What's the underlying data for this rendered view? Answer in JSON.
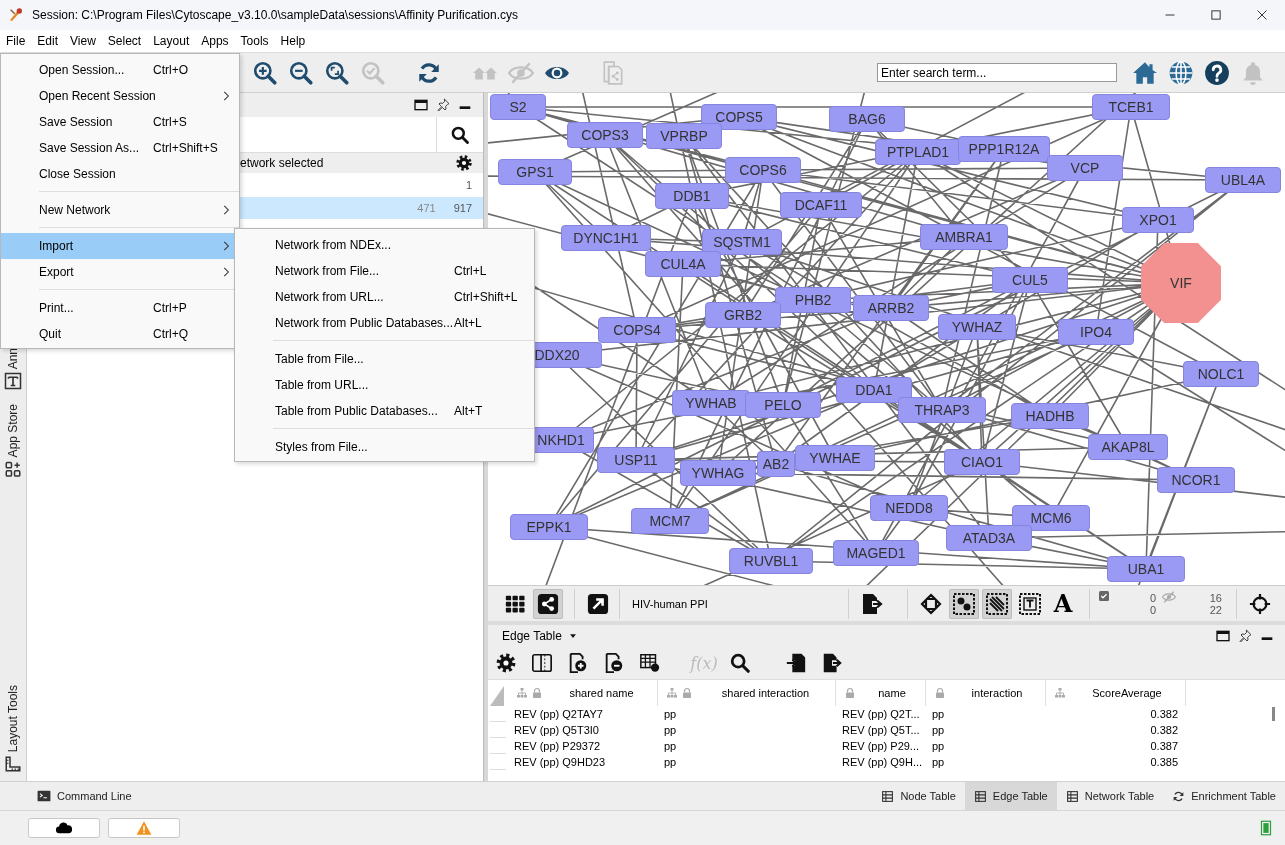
{
  "window": {
    "title": "Session: C:\\Program Files\\Cytoscape_v3.10.0\\sampleData\\sessions\\Affinity Purification.cys"
  },
  "menu_bar": [
    "File",
    "Edit",
    "View",
    "Select",
    "Layout",
    "Apps",
    "Tools",
    "Help"
  ],
  "file_menu": [
    {
      "kind": "item",
      "label": "Open Session...",
      "shortcut": "Ctrl+O",
      "submenu": false,
      "selected": false
    },
    {
      "kind": "item",
      "label": "Open Recent Session",
      "submenu": true,
      "selected": false
    },
    {
      "kind": "item",
      "label": "Save Session",
      "shortcut": "Ctrl+S",
      "submenu": false,
      "selected": false
    },
    {
      "kind": "item",
      "label": "Save Session As...",
      "shortcut": "Ctrl+Shift+S",
      "submenu": false,
      "selected": false
    },
    {
      "kind": "item",
      "label": "Close Session",
      "submenu": false,
      "selected": false
    },
    {
      "kind": "separator"
    },
    {
      "kind": "item",
      "label": "New Network",
      "submenu": true,
      "selected": false
    },
    {
      "kind": "separator"
    },
    {
      "kind": "item",
      "label": "Import",
      "submenu": true,
      "selected": true
    },
    {
      "kind": "item",
      "label": "Export",
      "submenu": true,
      "selected": false
    },
    {
      "kind": "separator"
    },
    {
      "kind": "item",
      "label": "Print...",
      "shortcut": "Ctrl+P",
      "submenu": false,
      "selected": false
    },
    {
      "kind": "item",
      "label": "Quit",
      "shortcut": "Ctrl+Q",
      "submenu": false,
      "selected": false
    }
  ],
  "import_submenu": [
    {
      "kind": "item",
      "label": "Network from NDEx..."
    },
    {
      "kind": "item",
      "label": "Network from File...",
      "shortcut": "Ctrl+L"
    },
    {
      "kind": "item",
      "label": "Network from URL...",
      "shortcut": "Ctrl+Shift+L"
    },
    {
      "kind": "item",
      "label": "Network from Public Databases...",
      "shortcut": "Alt+L"
    },
    {
      "kind": "separator"
    },
    {
      "kind": "item",
      "label": "Table from File..."
    },
    {
      "kind": "item",
      "label": "Table from URL..."
    },
    {
      "kind": "item",
      "label": "Table from Public Databases...",
      "shortcut": "Alt+T"
    },
    {
      "kind": "separator"
    },
    {
      "kind": "item",
      "label": "Styles from File..."
    }
  ],
  "toolbar": {
    "buttons": [
      {
        "kind": "zoom-in",
        "disabled": false
      },
      {
        "kind": "zoom-out",
        "disabled": false
      },
      {
        "kind": "zoom-fit",
        "disabled": false
      },
      {
        "kind": "zoom-check",
        "disabled": true
      },
      {
        "kind": "refresh",
        "disabled": false
      },
      {
        "kind": "houses",
        "disabled": true
      },
      {
        "kind": "eye-slash",
        "disabled": true
      },
      {
        "kind": "eye",
        "disabled": false
      },
      {
        "kind": "documents",
        "disabled": true
      }
    ],
    "search": {
      "placeholder": "Enter search term..."
    },
    "right_buttons": [
      {
        "kind": "home",
        "disabled": false
      },
      {
        "kind": "globe",
        "disabled": false
      },
      {
        "kind": "help",
        "disabled": false
      },
      {
        "kind": "bell",
        "disabled": true
      }
    ]
  },
  "side_tabs": [
    {
      "kind": "annotation",
      "label": "Ann"
    },
    {
      "kind": "app-store",
      "label": "App Store"
    },
    {
      "kind": "layout-tools",
      "label": "Layout Tools"
    }
  ],
  "network_panel": {
    "status": "etwork selected",
    "rows": [
      {
        "values": [
          "1"
        ],
        "selected": false
      },
      {
        "values": [
          "471",
          "917"
        ],
        "selected": true
      }
    ]
  },
  "network_view": {
    "nodes": [
      {
        "label": "S2",
        "kind": "rect"
      },
      {
        "label": "COPS5",
        "kind": "rect"
      },
      {
        "label": "BAG6",
        "kind": "rect"
      },
      {
        "label": "TCEB1",
        "kind": "rect"
      },
      {
        "label": "COPS3",
        "kind": "rect"
      },
      {
        "label": "VPRBP",
        "kind": "rect"
      },
      {
        "label": "PTPLAD1",
        "kind": "rect"
      },
      {
        "label": "PPP1R12A",
        "kind": "rect"
      },
      {
        "label": "GPS1",
        "kind": "rect"
      },
      {
        "label": "COPS6",
        "kind": "rect"
      },
      {
        "label": "VCP",
        "kind": "rect"
      },
      {
        "label": "UBL4A",
        "kind": "rect"
      },
      {
        "label": "DDB1",
        "kind": "rect"
      },
      {
        "label": "DCAF11",
        "kind": "rect"
      },
      {
        "label": "XPO1",
        "kind": "rect"
      },
      {
        "label": "DYNC1H1",
        "kind": "rect"
      },
      {
        "label": "SQSTM1",
        "kind": "rect"
      },
      {
        "label": "AMBRA1",
        "kind": "rect"
      },
      {
        "label": "CUL4A",
        "kind": "rect"
      },
      {
        "label": "CUL5",
        "kind": "rect"
      },
      {
        "label": "VIF",
        "kind": "octagon"
      },
      {
        "label": "PHB2",
        "kind": "rect"
      },
      {
        "label": "ARRB2",
        "kind": "rect"
      },
      {
        "label": "GRB2",
        "kind": "rect"
      },
      {
        "label": "COPS4",
        "kind": "rect"
      },
      {
        "label": "YWHAZ",
        "kind": "rect"
      },
      {
        "label": "IPO4",
        "kind": "rect"
      },
      {
        "label": "DDX20",
        "kind": "rect"
      },
      {
        "label": "NOLC1",
        "kind": "rect"
      },
      {
        "label": "DDA1",
        "kind": "rect"
      },
      {
        "label": "THRAP3",
        "kind": "rect"
      },
      {
        "label": "YWHAB",
        "kind": "rect"
      },
      {
        "label": "PELO",
        "kind": "rect"
      },
      {
        "label": "HADHB",
        "kind": "rect"
      },
      {
        "label": "AKAP8L",
        "kind": "rect"
      },
      {
        "label": "NKHD1",
        "kind": "rect"
      },
      {
        "label": "CIAO1",
        "kind": "rect"
      },
      {
        "label": "YWHAE",
        "kind": "rect"
      },
      {
        "label": "AB2",
        "kind": "rect"
      },
      {
        "label": "USP11",
        "kind": "rect"
      },
      {
        "label": "YWHAG",
        "kind": "rect"
      },
      {
        "label": "NCOR1",
        "kind": "rect"
      },
      {
        "label": "NEDD8",
        "kind": "rect"
      },
      {
        "label": "MCM6",
        "kind": "rect"
      },
      {
        "label": "EPPK1",
        "kind": "rect"
      },
      {
        "label": "MCM7",
        "kind": "rect"
      },
      {
        "label": "ATAD3A",
        "kind": "rect"
      },
      {
        "label": "MAGED1",
        "kind": "rect"
      },
      {
        "label": "RUVBL1",
        "kind": "rect"
      },
      {
        "label": "UBA1",
        "kind": "rect"
      }
    ],
    "toolbar": {
      "left_buttons": [
        {
          "kind": "grid",
          "selected": false
        },
        {
          "kind": "share",
          "selected": true
        },
        {
          "kind": "arrow-out",
          "selected": false
        }
      ],
      "network_name": "HIV-human PPI",
      "buttons": [
        {
          "kind": "export",
          "selected": false
        },
        {
          "kind": "move",
          "selected": false
        },
        {
          "kind": "select-nodes",
          "selected": true
        },
        {
          "kind": "select-edges",
          "selected": true
        },
        {
          "kind": "select-annotations",
          "selected": false
        },
        {
          "kind": "text-move",
          "label": "A",
          "selected": false
        }
      ],
      "selected_counts": [
        "0",
        "0"
      ],
      "hidden_counts": [
        "16",
        "22"
      ]
    }
  },
  "edge_table": {
    "title": "Edge Table",
    "toolbar": [
      {
        "kind": "gear",
        "disabled": false
      },
      {
        "kind": "columns",
        "disabled": false
      },
      {
        "kind": "add-column",
        "disabled": false
      },
      {
        "kind": "delete-column",
        "disabled": false
      },
      {
        "kind": "table",
        "disabled": false
      },
      {
        "kind": "function",
        "label": "f(x)",
        "disabled": true
      },
      {
        "kind": "search",
        "disabled": false
      },
      {
        "kind": "import",
        "disabled": false
      },
      {
        "kind": "export",
        "disabled": false
      }
    ],
    "columns": [
      {
        "label": "shared name",
        "shared": true,
        "locked": true
      },
      {
        "label": "shared interaction",
        "shared": true,
        "locked": true
      },
      {
        "label": "name",
        "shared": false,
        "locked": true
      },
      {
        "label": "interaction",
        "shared": false,
        "locked": true
      },
      {
        "label": "ScoreAverage",
        "shared": true,
        "locked": false
      }
    ],
    "rows": [
      [
        "REV (pp) Q2TAY7",
        "pp",
        "REV (pp) Q2T...",
        "pp",
        "0.382"
      ],
      [
        "REV (pp) Q5T3I0",
        "pp",
        "REV (pp) Q5T...",
        "pp",
        "0.382"
      ],
      [
        "REV (pp) P29372",
        "pp",
        "REV (pp) P29...",
        "pp",
        "0.387"
      ],
      [
        "REV (pp) Q9HD23",
        "pp",
        "REV (pp) Q9H...",
        "pp",
        "0.385"
      ]
    ]
  },
  "bottom_tabs": {
    "left": {
      "label": "Command Line"
    },
    "tabs": [
      {
        "kind": "node-table",
        "label": "Node Table",
        "selected": false
      },
      {
        "kind": "edge-table",
        "label": "Edge Table",
        "selected": true
      },
      {
        "kind": "network-table",
        "label": "Network Table",
        "selected": false
      },
      {
        "kind": "enrichment-table",
        "label": "Enrichment Table",
        "selected": false
      }
    ]
  }
}
